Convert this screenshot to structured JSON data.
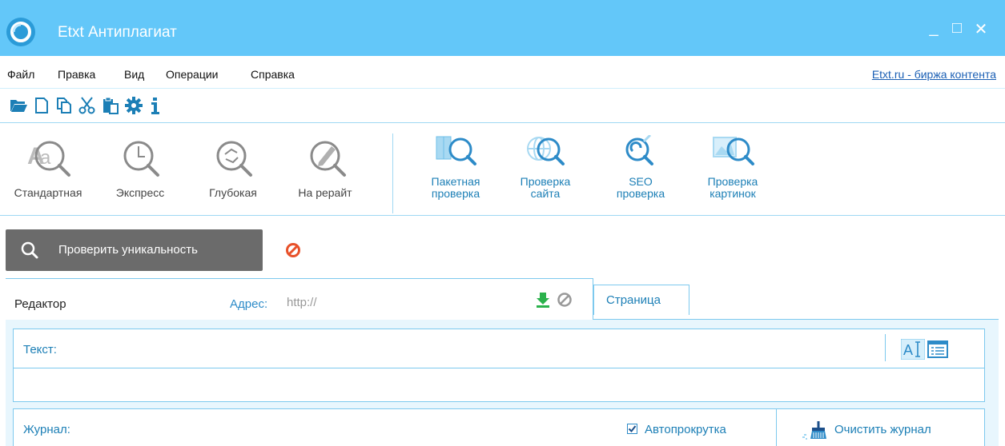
{
  "window": {
    "title": "Etxt Антиплагиат",
    "minimize": "_",
    "maximize": "□",
    "close": "✕"
  },
  "menu": {
    "items": [
      "Файл",
      "Правка",
      "Вид",
      "Операции",
      "Справка"
    ],
    "link": "Etxt.ru - биржа контента"
  },
  "toolbar": {
    "icons": [
      "folder-open-icon",
      "new-file-icon",
      "copy-icon",
      "cut-icon",
      "paste-icon",
      "gear-icon",
      "info-icon"
    ]
  },
  "ribbon": {
    "modes": [
      {
        "line1": "Стандартная",
        "line2": ""
      },
      {
        "line1": "Экспресс",
        "line2": ""
      },
      {
        "line1": "Глубокая",
        "line2": ""
      },
      {
        "line1": "На рерайт",
        "line2": ""
      }
    ],
    "tools": [
      {
        "line1": "Пакетная",
        "line2": "проверка"
      },
      {
        "line1": "Проверка",
        "line2": "сайта"
      },
      {
        "line1": "SEO",
        "line2": "проверка"
      },
      {
        "line1": "Проверка",
        "line2": "картинок"
      }
    ]
  },
  "actions": {
    "check_label": "Проверить уникальность"
  },
  "tabs": {
    "editor": "Редактор",
    "page": "Страница",
    "address_label": "Адрес:",
    "address_placeholder": "http://",
    "address_value": ""
  },
  "text_panel": {
    "title": "Текст:"
  },
  "log_panel": {
    "title": "Журнал:",
    "autoscroll_label": "Автопрокрутка",
    "autoscroll_checked": true,
    "clear_label": "Очистить журнал"
  },
  "colors": {
    "titlebar": "#63c7f9",
    "accent": "#1c7fb6",
    "border": "#7dc9ee",
    "check_button": "#6b6b6b",
    "stop": "#e8512a"
  }
}
